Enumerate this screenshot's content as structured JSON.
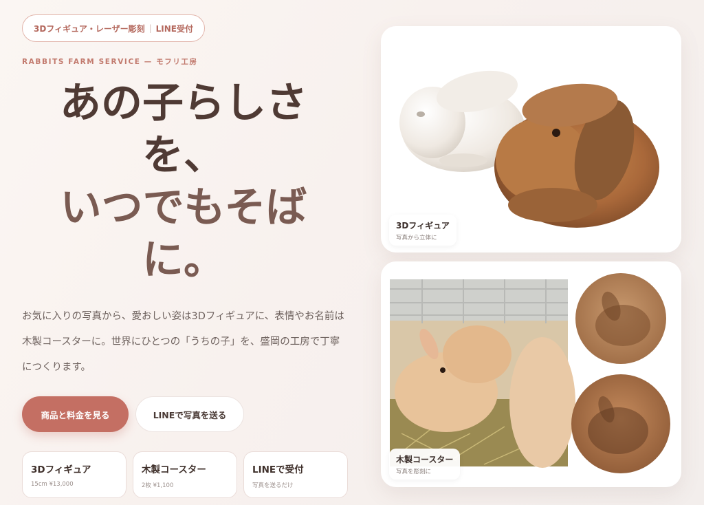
{
  "badge": {
    "part1": "3Dフィギュア・レーザー彫刻",
    "separator": "|",
    "part2": "LINE受付"
  },
  "kicker": "RABBITS FARM SERVICE — モフリ工房",
  "headline": [
    "あの子らしさ",
    "を、",
    "いつでもそば",
    "に。"
  ],
  "lead": "お気に入りの写真から、愛おしい姿は3Dフィギュアに、表情やお名前は木製コースターに。世界にひとつの「うちの子」を、盛岡の工房で丁寧につくります。",
  "buttons": {
    "primary": "商品と料金を見る",
    "secondary": "LINEで写真を送る"
  },
  "info_cards": [
    {
      "title": "3Dフィギュア",
      "sub": "15cm ¥13,000"
    },
    {
      "title": "木製コースター",
      "sub": "2枚 ¥1,100"
    },
    {
      "title": "LINEで受付",
      "sub": "写真を送るだけ"
    }
  ],
  "gallery": [
    {
      "title": "3Dフィギュア",
      "sub": "写真から立体に"
    },
    {
      "title": "木製コースター",
      "sub": "写真を彫刻に"
    }
  ],
  "colors": {
    "accent": "#c46f63",
    "heading": "#4f3a34",
    "kicker": "#c27a6e"
  }
}
